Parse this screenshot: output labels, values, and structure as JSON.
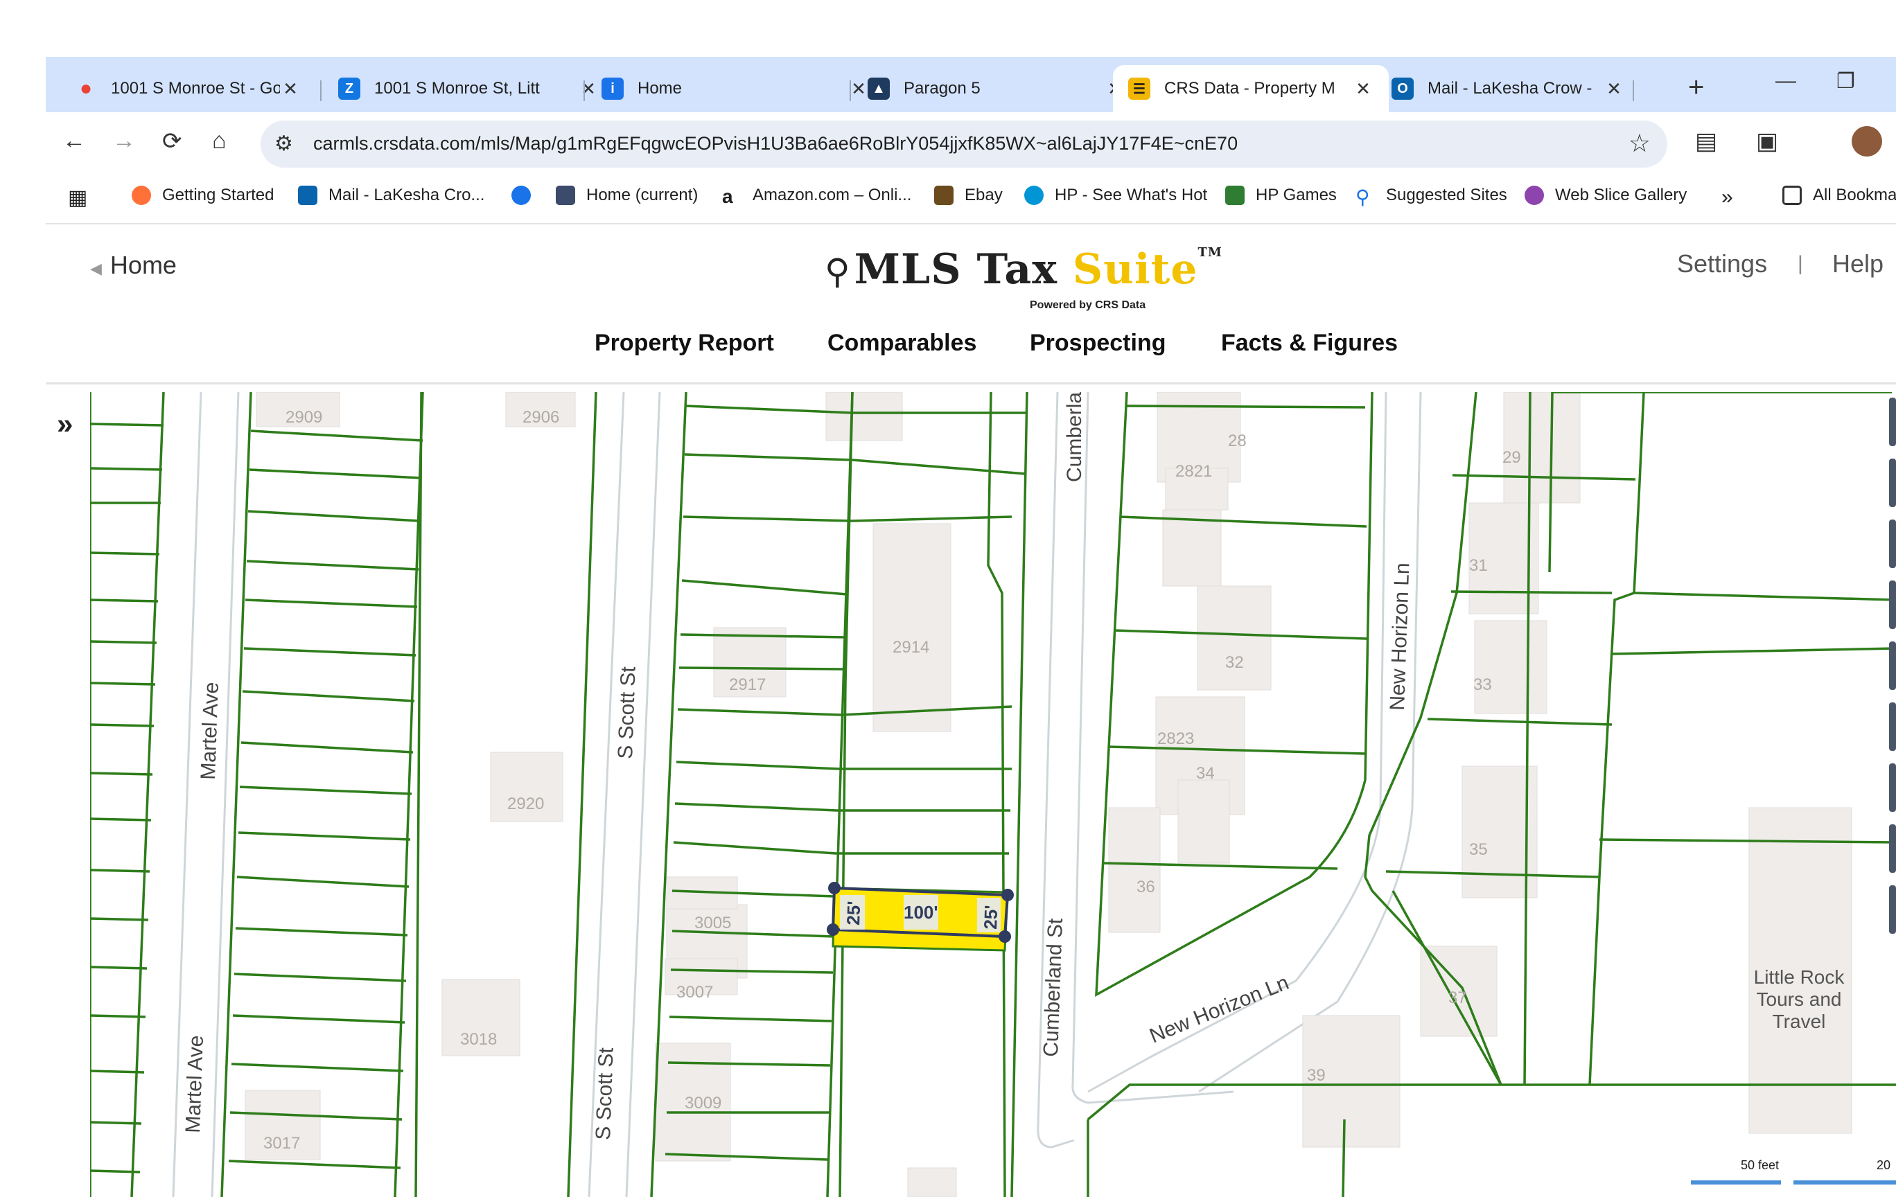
{
  "browser": {
    "tabs": [
      {
        "title": "1001 S Monroe St - Go",
        "icon": "google-maps-icon",
        "color": "#34a853"
      },
      {
        "title": "1001 S Monroe St, Litt",
        "icon": "zillow-icon",
        "color": "#1277e1"
      },
      {
        "title": "Home",
        "icon": "info-icon",
        "color": "#1a73e8"
      },
      {
        "title": "Paragon 5",
        "icon": "paragon-icon",
        "color": "#1e3a5f"
      },
      {
        "title": "CRS Data - Property M",
        "icon": "crs-data-icon",
        "color": "#f2b705"
      },
      {
        "title": "Mail - LaKesha Crow -",
        "icon": "outlook-icon",
        "color": "#0a64ad"
      }
    ],
    "url": "carmls.crsdata.com/mls/Map/g1mRgEFqgwcEOPvisH1U3Ba6ae6RoBlrY054jjxfK85WX~al6LajJY17F4E~cnE70",
    "bookmarks": [
      {
        "label": "Getting Started",
        "icon": "firefox-icon",
        "color": "#ff7139"
      },
      {
        "label": "Mail - LaKesha Cro...",
        "icon": "outlook-icon",
        "color": "#0a64ad"
      },
      {
        "label": "",
        "icon": "app-icon",
        "color": "#1a73e8"
      },
      {
        "label": "Home (current)",
        "icon": "home-current-icon",
        "color": "#3c4a6b"
      },
      {
        "label": "Amazon.com – Onli...",
        "icon": "amazon-icon",
        "color": "#222222"
      },
      {
        "label": "Ebay",
        "icon": "ebay-icon",
        "color": "#e53238"
      },
      {
        "label": "HP - See What's Hot",
        "icon": "hp-icon",
        "color": "#0096d6"
      },
      {
        "label": "HP Games",
        "icon": "hp-games-icon",
        "color": "#2e7d32"
      },
      {
        "label": "Suggested Sites",
        "icon": "search-icon",
        "color": "#1a73e8"
      },
      {
        "label": "Web Slice Gallery",
        "icon": "web-slice-icon",
        "color": "#8e44ad"
      }
    ],
    "all_bookmarks": "All Bookma"
  },
  "app": {
    "home": "Home",
    "logo_main": "MLS Tax ",
    "logo_suite": "Suite",
    "logo_tm": "TM",
    "logo_powered": "Powered by CRS Data",
    "settings": "Settings",
    "separator": "|",
    "help": "Help",
    "nav": [
      "Property Report",
      "Comparables",
      "Prospecting",
      "Facts & Figures"
    ]
  },
  "map": {
    "streets": [
      "Martel Ave",
      "Martel Ave",
      "S Scott St",
      "S Scott St",
      "Cumberland St",
      "Cumberla",
      "New Horizon Ln",
      "New Horizon Ln"
    ],
    "parcel_numbers": [
      "2909",
      "2906",
      "2917",
      "2914",
      "2920",
      "3005",
      "3007",
      "3009",
      "3018",
      "3017",
      "28",
      "2821",
      "29",
      "31",
      "32",
      "2823",
      "34",
      "33",
      "36",
      "35",
      "37",
      "39"
    ],
    "poi": [
      "Little Rock",
      "Tours and",
      "Travel"
    ],
    "measurements": [
      "25'",
      "100'",
      "25'"
    ],
    "scale_label": "50 feet",
    "scale_label_2": "20",
    "highlight_color": "#ffe600",
    "parcel_line_color": "#2e7d1a"
  }
}
